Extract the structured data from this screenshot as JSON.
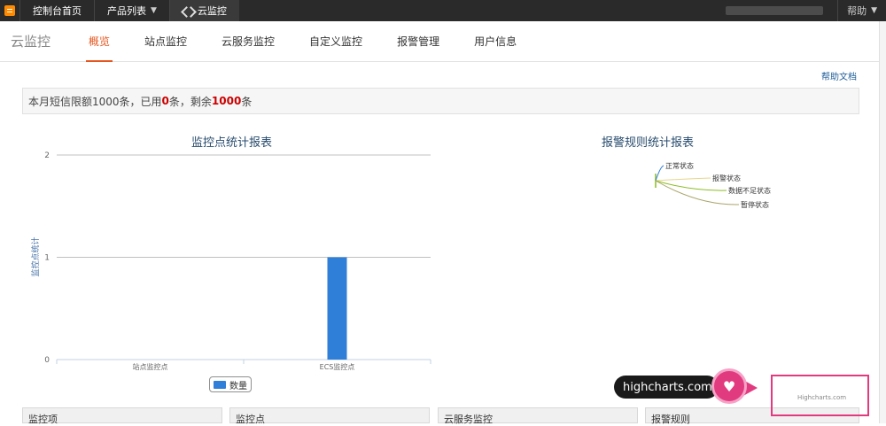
{
  "topbar": {
    "items": [
      {
        "label": "控制台首页"
      },
      {
        "label": "产品列表"
      },
      {
        "label": "云监控"
      }
    ],
    "help": "帮助"
  },
  "nav": {
    "product_title": "云监控",
    "tabs": [
      {
        "label": "概览",
        "active": true
      },
      {
        "label": "站点监控"
      },
      {
        "label": "云服务监控"
      },
      {
        "label": "自定义监控"
      },
      {
        "label": "报警管理"
      },
      {
        "label": "用户信息"
      }
    ]
  },
  "help_doc": "帮助文档",
  "notice": {
    "prefix": "本月短信限额1000条，已用",
    "used": "0",
    "middle": "条，剩余",
    "remaining": "1000",
    "suffix": "条"
  },
  "chart_data": [
    {
      "type": "bar",
      "title": "监控点统计报表",
      "ylabel": "监控点统计",
      "categories": [
        "站点监控点",
        "ECS监控点"
      ],
      "series": [
        {
          "name": "数量",
          "values": [
            0,
            1
          ],
          "color": "#2f7ed8"
        }
      ],
      "ylim": [
        0,
        2
      ],
      "yticks": [
        0,
        1,
        2
      ],
      "grid": true,
      "legend": "bottom-center"
    },
    {
      "type": "pie",
      "title": "报警规则统计报表",
      "labels": [
        "正常状态",
        "报警状态",
        "数据不足状态",
        "暂停状态"
      ],
      "values": [
        0,
        0,
        0,
        0
      ]
    }
  ],
  "panels": [
    {
      "label": "监控项"
    },
    {
      "label": "监控点"
    },
    {
      "label": "云服务监控"
    },
    {
      "label": "报警规则"
    }
  ],
  "promo": {
    "text": "highcharts.com"
  },
  "credit": "Highcharts.com"
}
